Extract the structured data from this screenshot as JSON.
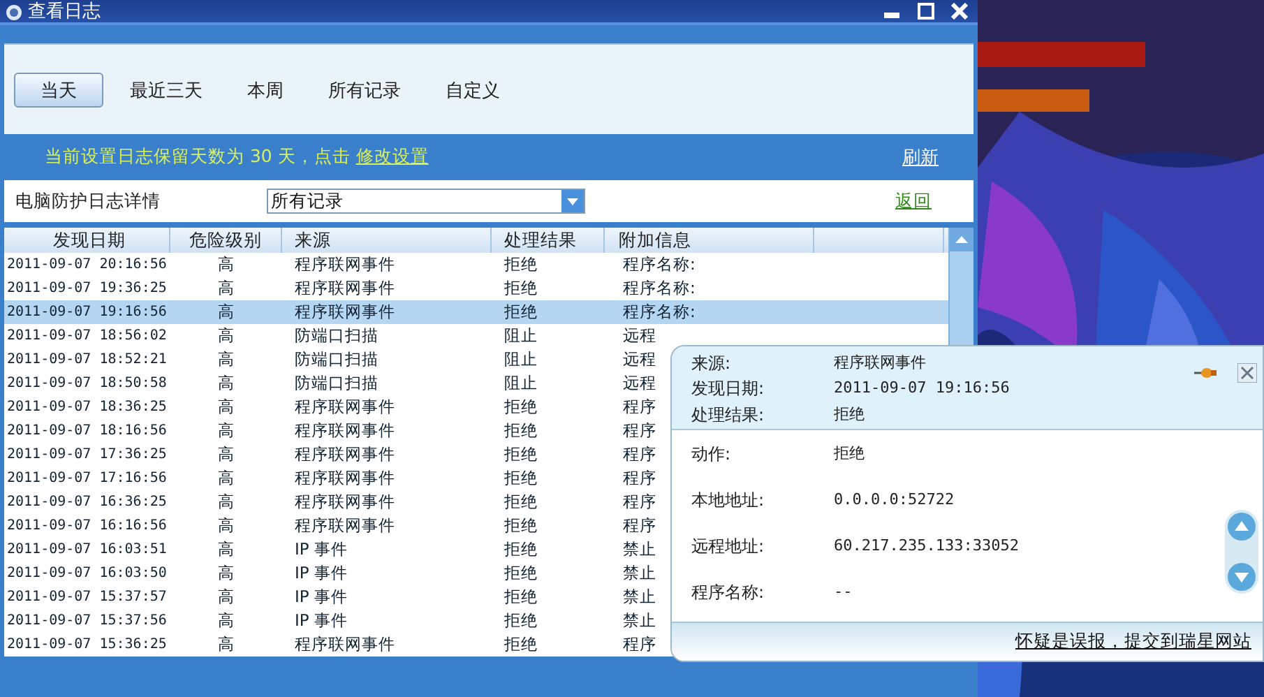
{
  "window": {
    "title": "查看日志"
  },
  "tabs": [
    {
      "label": "当天",
      "selected": true
    },
    {
      "label": "最近三天",
      "selected": false
    },
    {
      "label": "本周",
      "selected": false
    },
    {
      "label": "所有记录",
      "selected": false
    },
    {
      "label": "自定义",
      "selected": false
    }
  ],
  "info_bar": {
    "message": "当前设置日志保留天数为 30 天，点击 ",
    "link": "修改设置",
    "refresh": "刷新"
  },
  "filter": {
    "label": "电脑防护日志详情",
    "value": "所有记录",
    "back": "返回"
  },
  "table": {
    "columns": [
      "发现日期",
      "危险级别",
      "来源",
      "处理结果",
      "附加信息"
    ],
    "rows": [
      {
        "date": "2011-09-07 20:16:56",
        "level": "高",
        "source": "程序联网事件",
        "result": "拒绝",
        "extra": "程序名称:",
        "selected": false
      },
      {
        "date": "2011-09-07 19:36:25",
        "level": "高",
        "source": "程序联网事件",
        "result": "拒绝",
        "extra": "程序名称:",
        "selected": false
      },
      {
        "date": "2011-09-07 19:16:56",
        "level": "高",
        "source": "程序联网事件",
        "result": "拒绝",
        "extra": "程序名称:",
        "selected": true
      },
      {
        "date": "2011-09-07 18:56:02",
        "level": "高",
        "source": "防端口扫描",
        "result": "阻止",
        "extra": "远程",
        "selected": false
      },
      {
        "date": "2011-09-07 18:52:21",
        "level": "高",
        "source": "防端口扫描",
        "result": "阻止",
        "extra": "远程",
        "selected": false
      },
      {
        "date": "2011-09-07 18:50:58",
        "level": "高",
        "source": "防端口扫描",
        "result": "阻止",
        "extra": "远程",
        "selected": false
      },
      {
        "date": "2011-09-07 18:36:25",
        "level": "高",
        "source": "程序联网事件",
        "result": "拒绝",
        "extra": "程序",
        "selected": false
      },
      {
        "date": "2011-09-07 18:16:56",
        "level": "高",
        "source": "程序联网事件",
        "result": "拒绝",
        "extra": "程序",
        "selected": false
      },
      {
        "date": "2011-09-07 17:36:25",
        "level": "高",
        "source": "程序联网事件",
        "result": "拒绝",
        "extra": "程序",
        "selected": false
      },
      {
        "date": "2011-09-07 17:16:56",
        "level": "高",
        "source": "程序联网事件",
        "result": "拒绝",
        "extra": "程序",
        "selected": false
      },
      {
        "date": "2011-09-07 16:36:25",
        "level": "高",
        "source": "程序联网事件",
        "result": "拒绝",
        "extra": "程序",
        "selected": false
      },
      {
        "date": "2011-09-07 16:16:56",
        "level": "高",
        "source": "程序联网事件",
        "result": "拒绝",
        "extra": "程序",
        "selected": false
      },
      {
        "date": "2011-09-07 16:03:51",
        "level": "高",
        "source": "IP 事件",
        "result": "拒绝",
        "extra": "禁止",
        "selected": false
      },
      {
        "date": "2011-09-07 16:03:50",
        "level": "高",
        "source": "IP 事件",
        "result": "拒绝",
        "extra": "禁止",
        "selected": false
      },
      {
        "date": "2011-09-07 15:37:57",
        "level": "高",
        "source": "IP 事件",
        "result": "拒绝",
        "extra": "禁止",
        "selected": false
      },
      {
        "date": "2011-09-07 15:37:56",
        "level": "高",
        "source": "IP 事件",
        "result": "拒绝",
        "extra": "禁止",
        "selected": false
      },
      {
        "date": "2011-09-07 15:36:25",
        "level": "高",
        "source": "程序联网事件",
        "result": "拒绝",
        "extra": "程序",
        "selected": false
      }
    ]
  },
  "popup": {
    "summary": [
      {
        "label": "来源:",
        "value": "程序联网事件"
      },
      {
        "label": "发现日期:",
        "value": "2011-09-07 19:16:56"
      },
      {
        "label": "处理结果:",
        "value": "拒绝"
      }
    ],
    "details": [
      {
        "label": "动作:",
        "value": "拒绝"
      },
      {
        "label": "本地地址:",
        "value": "0.0.0.0:52722"
      },
      {
        "label": "远程地址:",
        "value": "60.217.235.133:33052"
      },
      {
        "label": "程序名称:",
        "value": "--"
      }
    ],
    "report_link": "怀疑是误报，提交到瑞星网站"
  }
}
